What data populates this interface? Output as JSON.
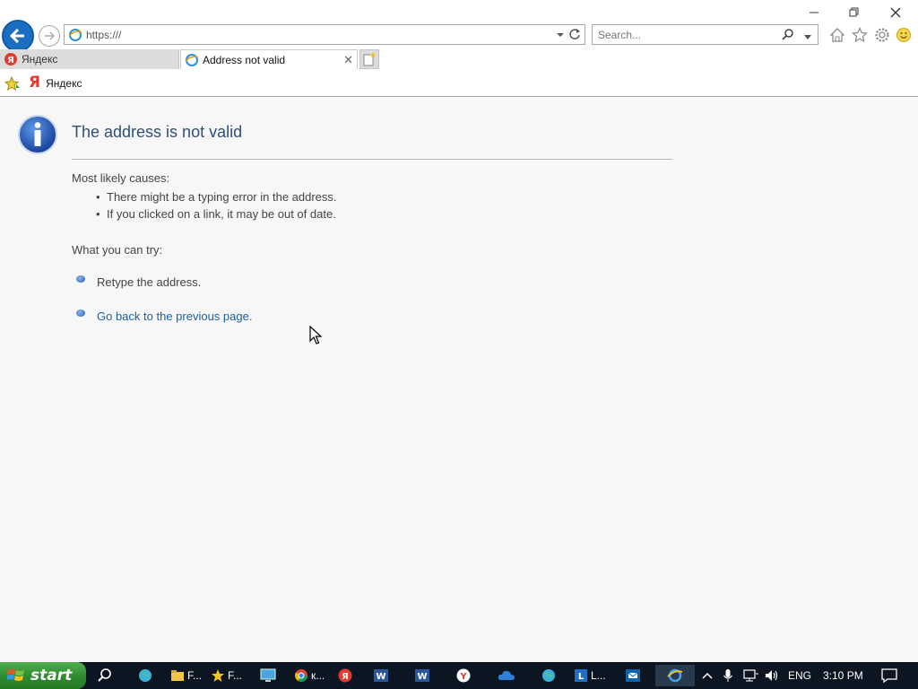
{
  "browser": {
    "address_url": "https:///",
    "search_placeholder": "Search...",
    "tabs": [
      {
        "label": "Яндекс",
        "active": false
      },
      {
        "label": "Address not valid",
        "active": true
      }
    ],
    "favorites": [
      {
        "label": "Яндекс"
      }
    ]
  },
  "page": {
    "title": "The address is not valid",
    "causes_heading": "Most likely causes:",
    "causes": [
      "There might be a typing error in the address.",
      "If you clicked on a link, it may be out of date."
    ],
    "try_heading": "What you can try:",
    "try_items": [
      {
        "label": "Retype the address.",
        "link": false
      },
      {
        "label": "Go back to the previous page.",
        "link": true
      }
    ]
  },
  "taskbar": {
    "start_label": "start",
    "items": [
      {
        "label": "F..."
      },
      {
        "label": "F..."
      },
      {
        "label": "к..."
      },
      {
        "label": "L..."
      }
    ],
    "language": "ENG",
    "time": "3:10 PM"
  },
  "colors": {
    "accent_blue": "#1c6fc0",
    "title_blue": "#2f4f78",
    "link_blue": "#1a5f9e",
    "start_green": "#2e8a2e",
    "taskbar_bg": "#0b1622"
  }
}
